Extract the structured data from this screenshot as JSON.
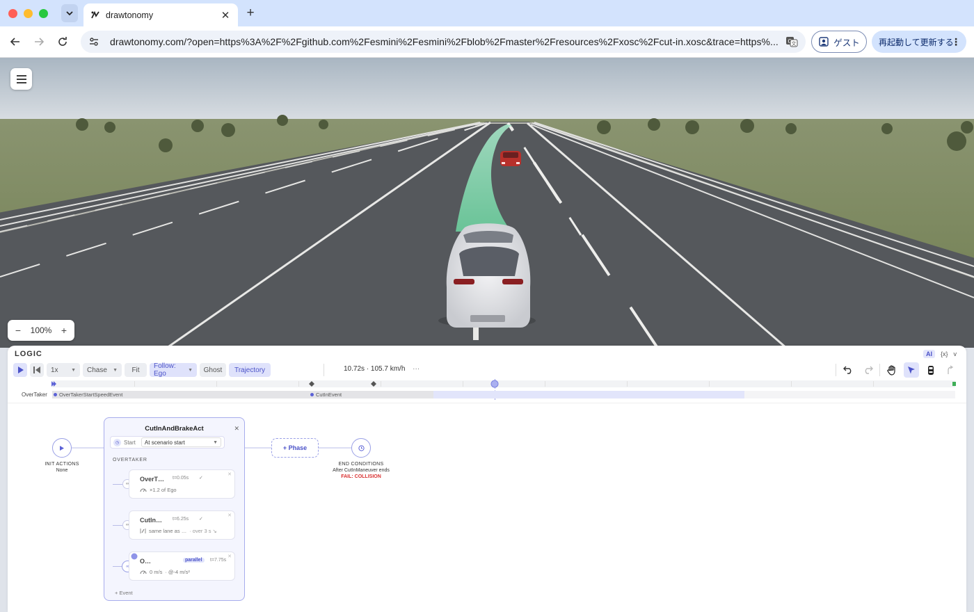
{
  "browser": {
    "tab_title": "drawtonomy",
    "url": "drawtonomy.com/?open=https%3A%2F%2Fgithub.com%2Fesmini%2Fesmini%2Fblob%2Fmaster%2Fresources%2Fxosc%2Fcut-in.xosc&trace=https%...",
    "guest_label": "ゲスト",
    "update_label": "再起動して更新する"
  },
  "viewport": {
    "zoom_level": "100%",
    "zoom_minus": "−",
    "zoom_plus": "+"
  },
  "panel": {
    "title": "LOGIC",
    "ai_label": "AI",
    "vars_label": "{x}",
    "collapse_label": "v",
    "speed": "1x",
    "camera": "Chase",
    "fit": "Fit",
    "follow": "Follow: Ego",
    "ghost": "Ghost",
    "trajectory": "Trajectory",
    "status": "10.72s · 105.7 km/h",
    "more": "···",
    "playhead_fraction": 0.49
  },
  "track": {
    "entity": "OverTaker",
    "event1": "OverTakerStartSpeedEvent",
    "event2": "CutInEvent"
  },
  "flow": {
    "init_title": "INIT ACTIONS",
    "init_value": "None",
    "act_title": "CutInAndBrakeAct",
    "start_label": "Start",
    "start_value": "At scenario start",
    "section": "OVERTAKER",
    "events": [
      {
        "name": "OverT…",
        "time": "t=0.05s",
        "check": "✓",
        "detail": "×1.2 of Ego",
        "extra": ""
      },
      {
        "name": "CutIn…",
        "time": "t=6.25s",
        "check": "✓",
        "detail": "same lane as …",
        "extra": "· over 3 s ↘"
      },
      {
        "name": "O…",
        "time": "t=7.75s",
        "badge": "parallel",
        "detail": "0 m/s",
        "extra": "· @-4 m/s²"
      }
    ],
    "add_event": "+ Event",
    "phase_btn": "+ Phase",
    "end_title": "END CONDITIONS",
    "end_value": "After CutInManeuver ends",
    "end_fail": "FAIL: COLLISION"
  },
  "colors": {
    "accent": "#5b61d6",
    "trajectory": "#7fd8b0",
    "ego_car": "#e9eaec",
    "other_car": "#c0332e",
    "fail": "#d93030"
  }
}
